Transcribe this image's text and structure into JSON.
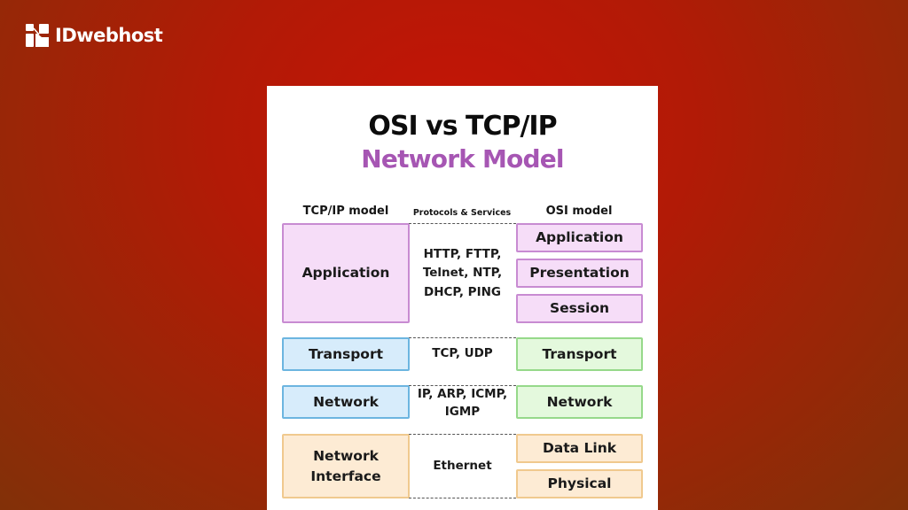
{
  "brand": {
    "name": "IDwebhost",
    "logo_icon": "idwebhost-logo-icon"
  },
  "colors": {
    "background_center": "#c41406",
    "background_edge": "#7e3208",
    "title_primary": "#0c0c0c",
    "title_accent": "#a656b3",
    "application_layer": "#f6ddf8",
    "transport_network_tcpip": "#d7ecfb",
    "transport_network_osi": "#e4f9dd",
    "link_physical": "#fdebd4"
  },
  "diagram": {
    "title_line1": "OSI vs TCP/IP",
    "title_line2": "Network Model",
    "columns": {
      "tcpip": "TCP/IP model",
      "protocols": "Protocols & Services",
      "osi": "OSI model"
    },
    "rows": [
      {
        "tcpip_layer": "Application",
        "protocols": "HTTP, FTTP, Telnet, NTP, DHCP, PING",
        "protocol_lines": [
          "HTTP, FTTP,",
          "Telnet, NTP,",
          "DHCP, PING"
        ],
        "osi_layers": [
          "Application",
          "Presentation",
          "Session"
        ]
      },
      {
        "tcpip_layer": "Transport",
        "protocols": "TCP, UDP",
        "protocol_lines": [
          "TCP, UDP"
        ],
        "osi_layers": [
          "Transport"
        ]
      },
      {
        "tcpip_layer": "Network",
        "protocols": "IP, ARP, ICMP, IGMP",
        "protocol_lines": [
          "IP, ARP, ICMP,",
          "IGMP"
        ],
        "osi_layers": [
          "Network"
        ]
      },
      {
        "tcpip_layer": "Network Interface",
        "tcpip_layer_lines": [
          "Network",
          "Interface"
        ],
        "protocols": "Ethernet",
        "protocol_lines": [
          "Ethernet"
        ],
        "osi_layers": [
          "Data Link",
          "Physical"
        ]
      }
    ]
  }
}
